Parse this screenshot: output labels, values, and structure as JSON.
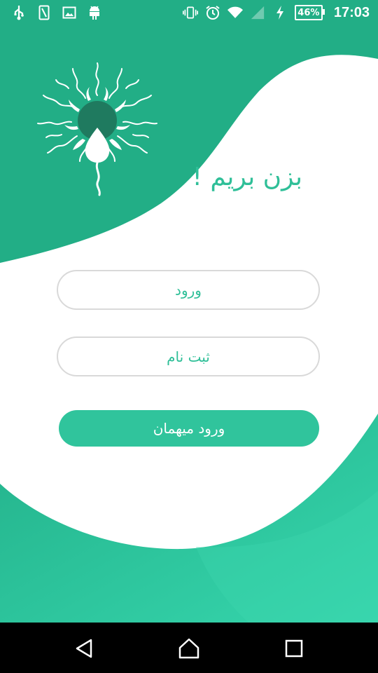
{
  "status_bar": {
    "time": "17:03",
    "battery_percent": "46%",
    "icons_left": [
      "usb-icon",
      "sim-icon",
      "image-icon",
      "android-icon"
    ],
    "icons_right": [
      "vibrate-icon",
      "alarm-icon",
      "wifi-icon",
      "signal-icon",
      "charging-icon"
    ]
  },
  "main": {
    "title": "بزن بریم !",
    "login_label": "ورود",
    "register_label": "ثبت نام",
    "guest_label": "ورود میهمان"
  },
  "colors": {
    "primary": "#22ae86",
    "primary_light": "#30c49c",
    "text_accent": "#2fbf98",
    "logo_dark": "#1f7a5f"
  },
  "nav_bar": {
    "icons": [
      "back-icon",
      "home-icon",
      "recents-icon"
    ]
  }
}
